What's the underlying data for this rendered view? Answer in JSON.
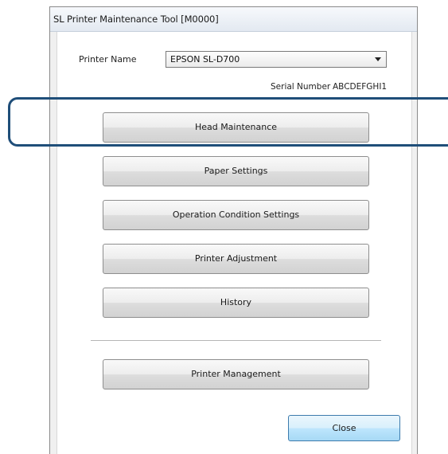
{
  "window": {
    "title": "SL Printer Maintenance Tool [M0000]"
  },
  "printer": {
    "label": "Printer Name",
    "selected": "EPSON SL-D700"
  },
  "serial": {
    "label": "Serial Number",
    "value": "ABCDEFGHI1"
  },
  "buttons": {
    "head_maintenance": "Head Maintenance",
    "paper_settings": "Paper Settings",
    "operation_condition_settings": "Operation Condition Settings",
    "printer_adjustment": "Printer Adjustment",
    "history": "History",
    "printer_management": "Printer Management",
    "close": "Close"
  },
  "colors": {
    "highlight": "#1f4e79",
    "close_accent": "#3d7bad"
  }
}
